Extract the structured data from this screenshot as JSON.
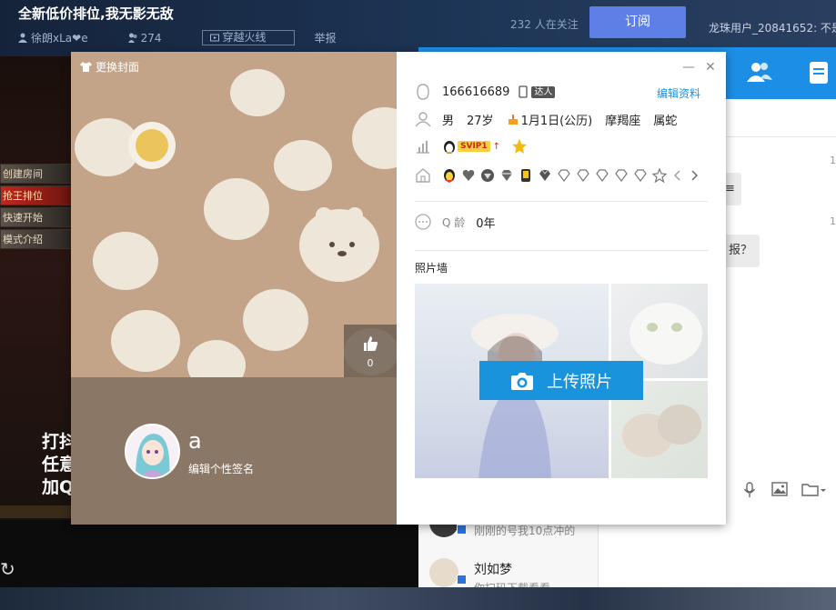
{
  "stream": {
    "title": "全新低价排位,我无影无敌",
    "streamer": "徐朗xLa❤e",
    "viewers": "274",
    "game": "穿越火线",
    "report": "举报",
    "followers": "232 人在关注",
    "subscribe": "订阅",
    "chat_user": "龙珠用户_20841652: 不是"
  },
  "video": {
    "menu": [
      "创建房间",
      "抢王排位",
      "快速开始",
      "模式介绍"
    ],
    "overlay_lines": "打抖\n任意\n加Q"
  },
  "chat": {
    "bubble1": "≡",
    "bubble2": "报？",
    "time1": "1",
    "time2": "1",
    "contacts": [
      {
        "name": "",
        "message": "刚刚的号我10点冲的"
      },
      {
        "name": "刘如梦",
        "message": "你扫码下载看看"
      }
    ]
  },
  "profile": {
    "change_cover": "更换封面",
    "likes": "0",
    "nickname": "a",
    "signature": "编辑个性签名",
    "qq_number": "166616689",
    "daren": "达人",
    "edit": "编辑资料",
    "gender": "男",
    "age": "27岁",
    "birthday": "1月1日(公历)",
    "zodiac": "摩羯座",
    "chinese_zodiac": "属蛇",
    "svip": "SVIP1",
    "svip_arrow": "↑",
    "q_age_label": "Q 龄",
    "q_age": "0年",
    "photo_wall": "照片墙",
    "upload": "上传照片"
  },
  "colors": {
    "accent": "#1d8ee6",
    "subscribe": "#5d7fe6",
    "upload": "#1993dc",
    "cover": "#c3a488"
  }
}
